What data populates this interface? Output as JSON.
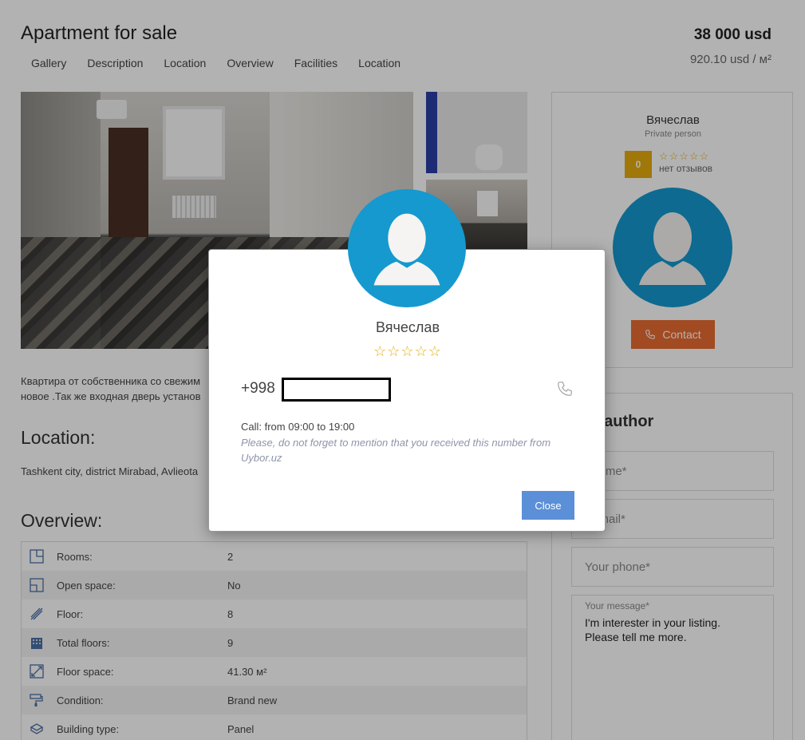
{
  "listing": {
    "title": "Apartment for sale",
    "price": "38 000 usd",
    "price_per_m2": "920.10 usd / м²",
    "tabs": [
      "Gallery",
      "Description",
      "Location",
      "Overview",
      "Facilities",
      "Location"
    ],
    "description": "Квартира от собственника со свежим новое .Так же входная дверь установ"
  },
  "location_section": {
    "heading": "Location:",
    "address": "Tashkent city, district Mirabad, Avlieota"
  },
  "overview_section": {
    "heading": "Overview:",
    "rows": [
      {
        "icon": "rooms-icon",
        "label": "Rooms:",
        "value": "2"
      },
      {
        "icon": "open-space-icon",
        "label": "Open space:",
        "value": "No"
      },
      {
        "icon": "floor-icon",
        "label": "Floor:",
        "value": "8"
      },
      {
        "icon": "building-icon",
        "label": "Total floors:",
        "value": "9"
      },
      {
        "icon": "floor-space-icon",
        "label": "Floor space:",
        "value": "41.30 м²"
      },
      {
        "icon": "paint-roller-icon",
        "label": "Condition:",
        "value": "Brand new"
      },
      {
        "icon": "panel-icon",
        "label": "Building type:",
        "value": "Panel"
      }
    ]
  },
  "author_card": {
    "name": "Вячеслав",
    "role": "Private person",
    "rating": "0",
    "stars": "☆☆☆☆☆",
    "reviews": "нет отзывов",
    "contact_label": "Contact"
  },
  "message_card": {
    "title": "e to author",
    "name_placeholder": "r name*",
    "email_placeholder": "r email*",
    "phone_placeholder": "Your phone*",
    "message_label": "Your message*",
    "message_text": "I'm interester in your listing.\nPlease tell me more."
  },
  "modal": {
    "name": "Вячеслав",
    "stars": "☆☆☆☆☆",
    "phone_prefix": "+998",
    "call_time": "Call: from 09:00 to 19:00",
    "note": "Please, do not forget to mention that you received this number from Uybor.uz",
    "close_label": "Close"
  },
  "colors": {
    "accent_blue": "#1599cf",
    "contact_orange": "#e86b30",
    "rating_gold": "#e6ad0f",
    "close_button": "#5b8fd8"
  }
}
